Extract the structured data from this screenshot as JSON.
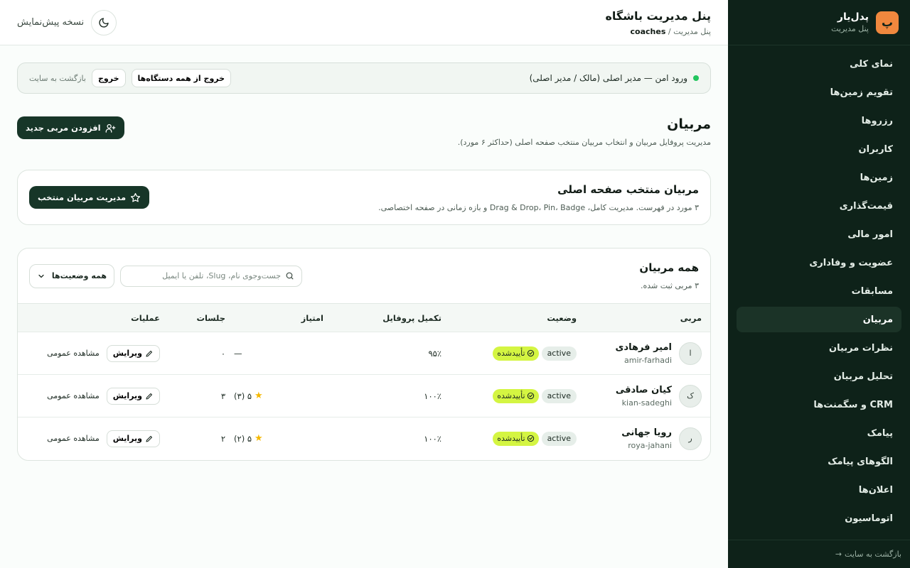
{
  "brand": {
    "logo_letter": "پ",
    "name": "پدل‌یار",
    "subtitle": "پنل مدیریت"
  },
  "sidebar": {
    "items": [
      {
        "label": "نمای کلی",
        "active": false
      },
      {
        "label": "تقویم زمین‌ها",
        "active": false
      },
      {
        "label": "رزروها",
        "active": false
      },
      {
        "label": "کاربران",
        "active": false
      },
      {
        "label": "زمین‌ها",
        "active": false
      },
      {
        "label": "قیمت‌گذاری",
        "active": false
      },
      {
        "label": "امور مالی",
        "active": false
      },
      {
        "label": "عضویت و وفاداری",
        "active": false
      },
      {
        "label": "مسابقات",
        "active": false
      },
      {
        "label": "مربیان",
        "active": true
      },
      {
        "label": "نظرات مربیان",
        "active": false
      },
      {
        "label": "تحلیل مربیان",
        "active": false
      },
      {
        "label": "CRM و سگمنت‌ها",
        "active": false
      },
      {
        "label": "پیامک",
        "active": false
      },
      {
        "label": "الگوهای پیامک",
        "active": false
      },
      {
        "label": "اعلان‌ها",
        "active": false
      },
      {
        "label": "اتوماسیون",
        "active": false
      }
    ],
    "footer_label": "بازگشت به سایت",
    "footer_arrow": "→"
  },
  "header": {
    "title": "پنل مدیریت باشگاه",
    "breadcrumb_root": "پنل مدیریت",
    "breadcrumb_sep": "/",
    "breadcrumb_current": "coaches",
    "preview_label": "نسخه پیش‌نمایش"
  },
  "secure_bar": {
    "text": "ورود امن — مدیر اصلی (مالک / مدیر اصلی)",
    "logout_all": "خروج از همه دستگاه‌ها",
    "logout": "خروج",
    "back_to_site": "بازگشت به سایت"
  },
  "page": {
    "title": "مربیان",
    "description": "مدیریت پروفایل مربیان و انتخاب مربیان منتخب صفحه اصلی (حداکثر ۶ مورد).",
    "add_button": "افزودن مربی جدید"
  },
  "featured": {
    "title": "مربیان منتخب صفحه اصلی",
    "description": "۳ مورد در فهرست. مدیریت کامل، Drag & Drop، Pin، Badge و بازه زمانی در صفحه اختصاصی.",
    "button": "مدیریت مربیان منتخب"
  },
  "list": {
    "title": "همه مربیان",
    "subtitle": "۳ مربی ثبت شده.",
    "search_placeholder": "جست‌وجوی نام، Slug، تلفن یا ایمیل",
    "status_filter": "همه وضعیت‌ها",
    "columns": {
      "coach": "مربی",
      "status": "وضعیت",
      "profile": "تکمیل پروفایل",
      "rating": "امتیاز",
      "sessions": "جلسات",
      "actions": "عملیات"
    },
    "edit_label": "ویرایش",
    "public_label": "مشاهده عمومی",
    "rows": [
      {
        "initial": "ا",
        "name": "امیر فرهادی",
        "slug": "amir-farhadi",
        "status": "active",
        "verified": "تأییدشده",
        "profile": "۹۵٪",
        "rating": "—",
        "has_rating": false,
        "sessions": "۰"
      },
      {
        "initial": "ک",
        "name": "کیان صادقی",
        "slug": "kian-sadeghi",
        "status": "active",
        "verified": "تأییدشده",
        "profile": "۱۰۰٪",
        "rating": "۵ (۳)",
        "has_rating": true,
        "sessions": "۳"
      },
      {
        "initial": "ر",
        "name": "رویا جهانی",
        "slug": "roya-jahani",
        "status": "active",
        "verified": "تأییدشده",
        "profile": "۱۰۰٪",
        "rating": "۵ (۲)",
        "has_rating": true,
        "sessions": "۲"
      }
    ]
  },
  "colors": {
    "sidebar_bg": "#0e2219",
    "accent": "#f0883e",
    "primary_button": "#173628",
    "verified_badge": "#d4f542",
    "star": "#f5b800"
  },
  "icons": {
    "theme": "moon-icon",
    "add": "user-plus-icon",
    "featured": "star-icon",
    "search": "search-icon",
    "select": "chevron-down-icon",
    "edit": "pencil-icon",
    "verified": "check-circle-icon"
  }
}
